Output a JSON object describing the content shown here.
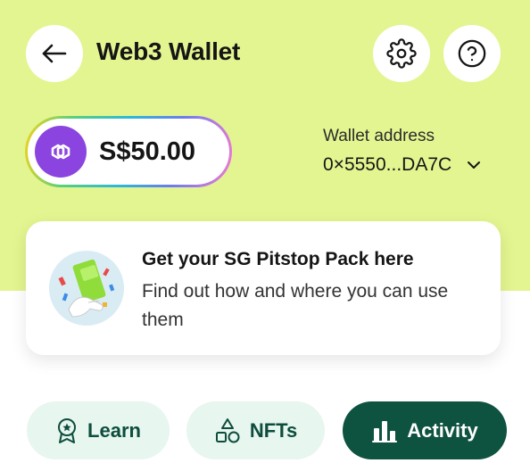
{
  "header": {
    "title": "Web3 Wallet"
  },
  "balance": {
    "amount": "S$50.00"
  },
  "wallet": {
    "label": "Wallet address",
    "address": "0×5550...DA7C"
  },
  "promo": {
    "title": "Get your SG Pitstop Pack here",
    "description": "Find out how and where you can use them"
  },
  "tabs": [
    {
      "label": "Learn",
      "icon": "award-icon",
      "selected": false
    },
    {
      "label": "NFTs",
      "icon": "shapes-icon",
      "selected": false
    },
    {
      "label": "Activity",
      "icon": "bar-chart-icon",
      "selected": true
    }
  ],
  "colors": {
    "header_background": "#e3f590",
    "token_purple": "#8b44df",
    "active_tab": "#0e5240",
    "inactive_tab": "#e7f6ef"
  },
  "icons": {
    "back": "back-arrow-icon",
    "settings": "gear-icon",
    "help": "help-icon",
    "token": "polygon-token-icon",
    "dropdown": "chevron-down-icon"
  }
}
